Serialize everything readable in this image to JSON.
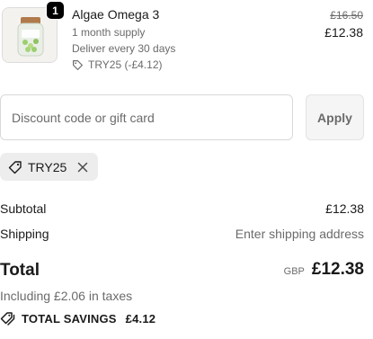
{
  "product": {
    "name": "Algae Omega 3",
    "quantity": "1",
    "supply": "1 month supply",
    "frequency": "Deliver every 30 days",
    "discount_line": "TRY25 (-£4.12)",
    "original_price": "£16.50",
    "price": "£12.38",
    "thumbnail_icon": "supplement-jar-image"
  },
  "discount": {
    "placeholder": "Discount code or gift card",
    "apply_label": "Apply",
    "applied_code": "TRY25"
  },
  "summary": {
    "subtotal_label": "Subtotal",
    "subtotal_value": "£12.38",
    "shipping_label": "Shipping",
    "shipping_value": "Enter shipping address",
    "total_label": "Total",
    "currency": "GBP",
    "total_value": "£12.38",
    "taxes_note": "Including £2.06 in taxes",
    "savings_label": "TOTAL SAVINGS",
    "savings_value": "£4.12"
  },
  "colors": {
    "text": "#1a1a1a",
    "muted": "#6b6b6b",
    "chip_bg": "#ededed",
    "badge_bg": "#000000"
  }
}
